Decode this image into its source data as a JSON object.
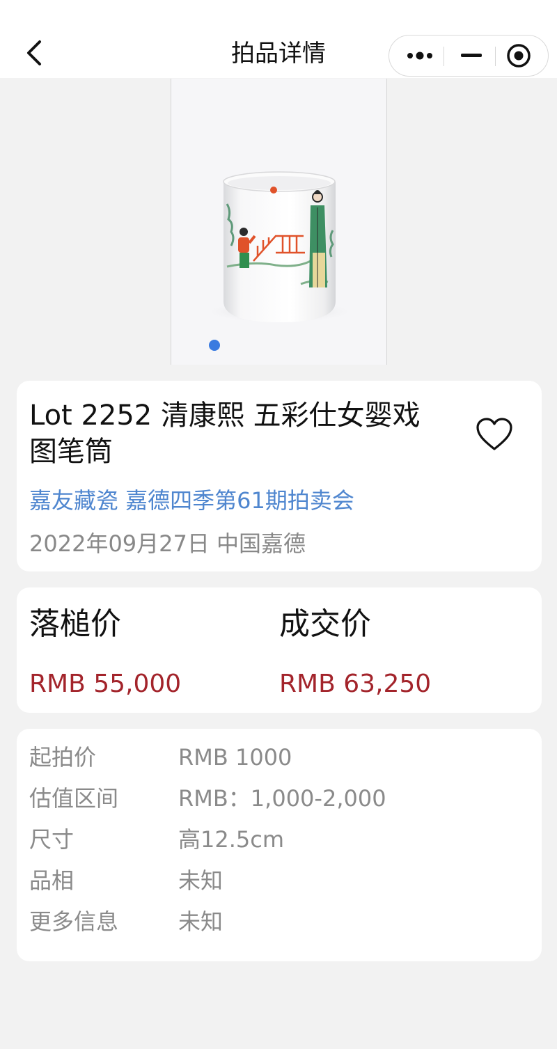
{
  "navbar": {
    "title": "拍品详情",
    "back_icon": "chevron-left-icon",
    "more_icon": "more-dots-icon",
    "minimize_icon": "minimize-icon",
    "close_icon": "target-close-icon"
  },
  "gallery": {
    "image_alt": "清康熙 五彩仕女婴戏图笔筒",
    "active_dot_color": "#3a7be0",
    "slide_count": 1
  },
  "lot": {
    "title": "Lot 2252 清康熙 五彩仕女婴戏图笔筒",
    "auction": "嘉友藏瓷 嘉德四季第61期拍卖会",
    "date_location": "2022年09月27日 中国嘉德",
    "favorite_icon": "heart-outline-icon"
  },
  "prices": {
    "hammer_label": "落槌价",
    "hammer_value": "RMB 55,000",
    "final_label": "成交价",
    "final_value": "RMB 63,250",
    "price_color": "#a3242b"
  },
  "details": [
    {
      "key": "起拍价",
      "value": "RMB 1000"
    },
    {
      "key": "估值区间",
      "value": "RMB：1,000-2,000"
    },
    {
      "key": "尺寸",
      "value": "高12.5cm"
    },
    {
      "key": "品相",
      "value": "未知"
    },
    {
      "key": "更多信息",
      "value": "未知"
    }
  ]
}
